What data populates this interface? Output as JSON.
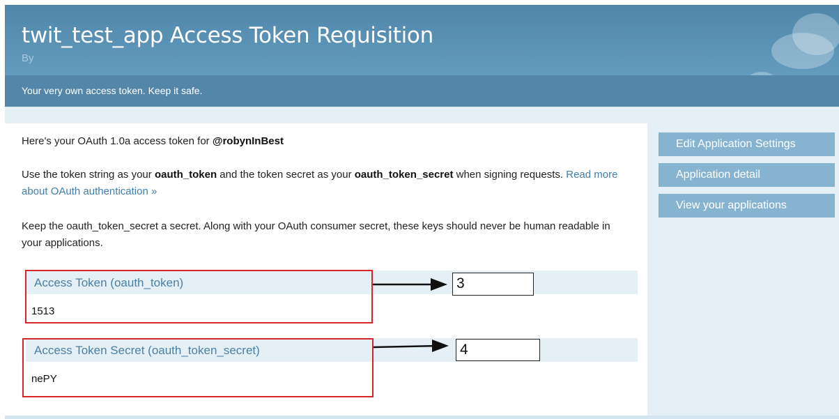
{
  "header": {
    "title": "twit_test_app Access Token Requisition",
    "by": "By",
    "tagline": "Your very own access token. Keep it safe."
  },
  "main": {
    "intro_prefix": "Here's your OAuth 1.0a access token for ",
    "intro_user": "@robynInBest",
    "usage_1": "Use the token string as your ",
    "usage_token": "oauth_token",
    "usage_2": " and the token secret as your ",
    "usage_secret": "oauth_token_secret",
    "usage_3": " when signing requests. ",
    "usage_link": "Read more about OAuth authentication »",
    "secret_note": "Keep the oauth_token_secret a secret. Along with your OAuth consumer secret, these keys should never be human readable in your applications.",
    "fields": [
      {
        "label": "Access Token (oauth_token)",
        "value": "1513"
      },
      {
        "label": "Access Token Secret (oauth_token_secret)",
        "value": "nePY"
      }
    ]
  },
  "annotations": {
    "box_3": "3",
    "box_4": "4"
  },
  "sidebar": {
    "buttons": [
      {
        "label": "Edit Application Settings"
      },
      {
        "label": "Application detail"
      },
      {
        "label": "View your applications"
      }
    ]
  },
  "colors": {
    "header": "#5486a9",
    "link": "#3f7eaa",
    "sidebar_button": "#86b4d0",
    "highlight_box": "#d9232a"
  }
}
